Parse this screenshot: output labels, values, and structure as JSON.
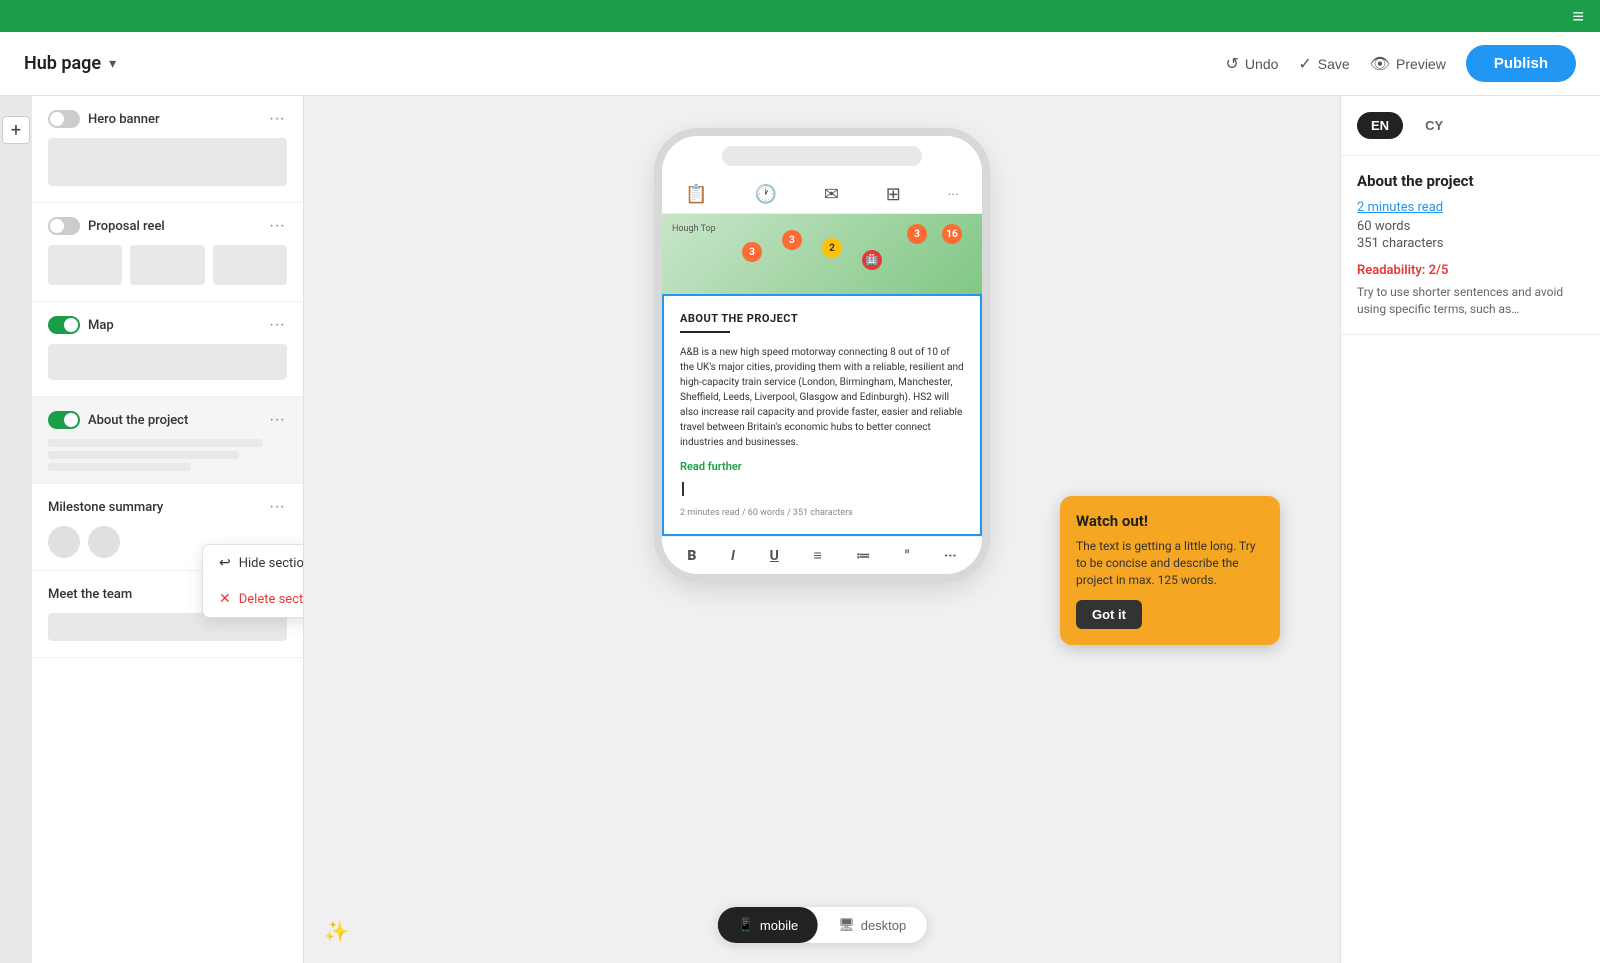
{
  "topbar": {
    "hamburger": "≡"
  },
  "header": {
    "title": "Hub page",
    "chevron": "▾",
    "undo_label": "Undo",
    "save_label": "Save",
    "preview_label": "Preview",
    "publish_label": "Publish"
  },
  "sections_panel": {
    "items": [
      {
        "id": "hero-banner",
        "name": "Hero banner",
        "toggle": "off",
        "preview_type": "bar"
      },
      {
        "id": "proposal-reel",
        "name": "Proposal reel",
        "toggle": "off",
        "preview_type": "row3"
      },
      {
        "id": "map",
        "name": "Map",
        "toggle": "on",
        "preview_type": "bar"
      },
      {
        "id": "about-project",
        "name": "About the project",
        "toggle": "on",
        "preview_type": "lines",
        "selected": true
      },
      {
        "id": "milestone-summary",
        "name": "Milestone summary",
        "toggle": null,
        "preview_type": "avatars"
      },
      {
        "id": "meet-the-team",
        "name": "Meet the team",
        "toggle": null,
        "preview_type": "none"
      }
    ]
  },
  "context_menu": {
    "hide_label": "Hide section",
    "delete_label": "Delete section"
  },
  "device": {
    "section_title": "ABOUT THE PROJECT",
    "body_text": "A&B is a new high speed motorway connecting 8 out of 10 of the UK's major cities, providing them with a reliable, resilient and high-capacity train service (London, Birmingham, Manchester, Sheffield, Leeds, Liverpool, Glasgow and Edinburgh). HS2 will also increase rail capacity and provide faster, easier and reliable travel between Britain's economic hubs to better connect industries and businesses.",
    "read_further": "Read further",
    "meta": "2 minutes read / 60 words / 351 characters"
  },
  "warning": {
    "title": "Watch out!",
    "text": "The text is getting a little long. Try to be concise and describe the project in max. 125 words.",
    "button_label": "Got it"
  },
  "right_panel": {
    "lang_en": "EN",
    "lang_cy": "CY",
    "section_title": "About the project",
    "read_time": "2 minutes read",
    "word_count": "60 words",
    "char_count": "351 characters",
    "readability_label": "Readability: 2/5",
    "readability_hint": "Try to use shorter sentences and avoid using specific terms, such as…"
  },
  "device_switcher": {
    "mobile_label": "mobile",
    "desktop_label": "desktop"
  }
}
